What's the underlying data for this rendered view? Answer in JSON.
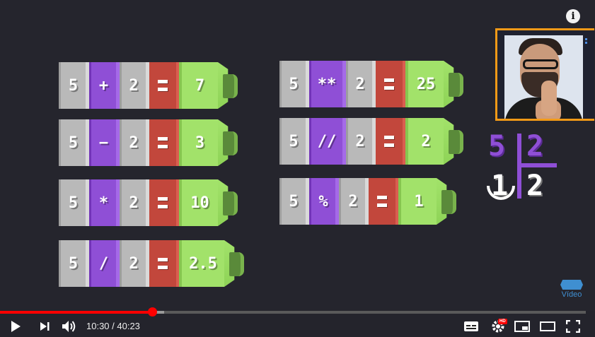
{
  "equations_left": [
    {
      "a": "5",
      "op": "+",
      "b": "2",
      "result": "7"
    },
    {
      "a": "5",
      "op": "−",
      "b": "2",
      "result": "3"
    },
    {
      "a": "5",
      "op": "*",
      "b": "2",
      "result": "10"
    },
    {
      "a": "5",
      "op": "/",
      "b": "2",
      "result": "2.5"
    }
  ],
  "equations_right": [
    {
      "a": "5",
      "op": "**",
      "b": "2",
      "result": "25"
    },
    {
      "a": "5",
      "op": "//",
      "b": "2",
      "result": "2"
    },
    {
      "a": "5",
      "op": "%",
      "b": "2",
      "result": "1"
    }
  ],
  "division_illustration": {
    "dividend": "5",
    "divisor": "2",
    "quotient": "2",
    "remainder": "1"
  },
  "overlay": {
    "info_icon": "info-icon",
    "video_badge_label": "Vídeo"
  },
  "player": {
    "current_time": "10:30",
    "duration": "40:23",
    "time_text": "10:30 / 40:23",
    "played_fraction": 0.26,
    "buffered_fraction": 0.28,
    "hd_badge": "HD"
  },
  "colors": {
    "number_block": "#b9b9b9",
    "operator_block": "#8f4fd6",
    "equals_block": "#c2473c",
    "result_block": "#a2e26a",
    "progress_played": "#ff0000",
    "webcam_border": "#f29a17"
  }
}
